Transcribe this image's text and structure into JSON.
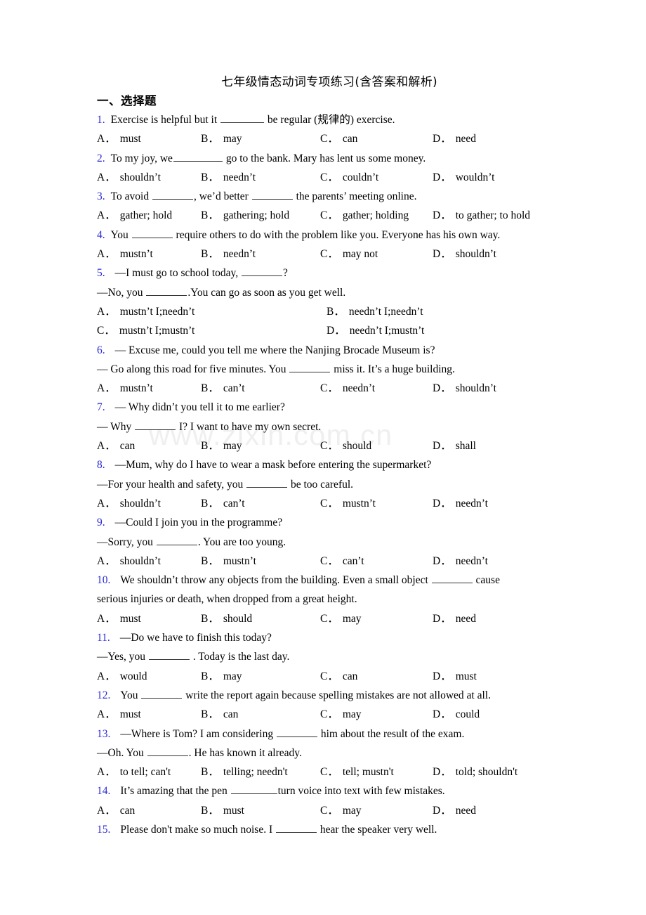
{
  "document": {
    "title": "七年级情态动词专项练习(含答案和解析)",
    "section_heading": "一、选择题",
    "watermark": "www.zixin.com.cn"
  },
  "questions": [
    {
      "number": "1.",
      "stem_parts": [
        "Exercise is helpful but it ",
        " be regular (规律的) exercise."
      ],
      "layout": "4col",
      "options": [
        {
          "key": "A．",
          "text": "must"
        },
        {
          "key": "B．",
          "text": "may"
        },
        {
          "key": "C．",
          "text": "can"
        },
        {
          "key": "D．",
          "text": "need"
        }
      ]
    },
    {
      "number": "2.",
      "stem_parts": [
        "To my joy, we",
        " go to the bank. Mary has lent us some money."
      ],
      "layout": "4col",
      "options": [
        {
          "key": "A．",
          "text": "shouldn’t"
        },
        {
          "key": "B．",
          "text": "needn’t"
        },
        {
          "key": "C．",
          "text": "couldn’t"
        },
        {
          "key": "D．",
          "text": "wouldn’t"
        }
      ]
    },
    {
      "number": "3.",
      "stem_parts": [
        "To avoid ",
        ", we’d better ",
        " the parents’ meeting online."
      ],
      "layout": "4col",
      "options": [
        {
          "key": "A．",
          "text": "gather; hold"
        },
        {
          "key": "B．",
          "text": "gathering; hold"
        },
        {
          "key": "C．",
          "text": "gather; holding"
        },
        {
          "key": "D．",
          "text": "to gather; to hold"
        }
      ]
    },
    {
      "number": "4.",
      "stem_parts": [
        "You ",
        " require others to do with the problem like you. Everyone has his own way."
      ],
      "layout": "4col",
      "options": [
        {
          "key": "A．",
          "text": "mustn’t"
        },
        {
          "key": "B．",
          "text": "needn’t"
        },
        {
          "key": "C．",
          "text": "may not"
        },
        {
          "key": "D．",
          "text": "shouldn’t"
        }
      ]
    },
    {
      "number": "5.",
      "stem_parts": [
        "—I must go to school today, ",
        "?"
      ],
      "stem_line2_parts": [
        "—No, you ",
        ".You can go as soon as you get well."
      ],
      "layout": "2col",
      "options": [
        {
          "key": "A．",
          "text": "mustn’t I;needn’t"
        },
        {
          "key": "B．",
          "text": "needn’t I;needn’t"
        },
        {
          "key": "C．",
          "text": "mustn’t I;mustn’t"
        },
        {
          "key": "D．",
          "text": "needn’t I;mustn’t"
        }
      ]
    },
    {
      "number": "6.",
      "stem_parts": [
        "— Excuse me, could you tell me where the Nanjing Brocade Museum is?"
      ],
      "stem_line2_parts": [
        "— Go along this road for five minutes. You ",
        " miss it. It’s a huge building."
      ],
      "layout": "4col",
      "options": [
        {
          "key": "A．",
          "text": "mustn’t"
        },
        {
          "key": "B．",
          "text": "can’t"
        },
        {
          "key": "C．",
          "text": "needn’t"
        },
        {
          "key": "D．",
          "text": "shouldn’t"
        }
      ]
    },
    {
      "number": "7.",
      "stem_parts": [
        "— Why didn’t you tell it to me earlier?"
      ],
      "stem_line2_parts": [
        "— Why ",
        " I? I want to have my own secret."
      ],
      "layout": "4col",
      "options": [
        {
          "key": "A．",
          "text": "can"
        },
        {
          "key": "B．",
          "text": "may"
        },
        {
          "key": "C．",
          "text": "should"
        },
        {
          "key": "D．",
          "text": "shall"
        }
      ]
    },
    {
      "number": "8.",
      "stem_parts": [
        "—Mum, why do I have to wear a mask before entering the supermarket?"
      ],
      "stem_line2_parts": [
        "—For your health and safety, you ",
        " be too careful."
      ],
      "layout": "4col",
      "options": [
        {
          "key": "A．",
          "text": "shouldn’t"
        },
        {
          "key": "B．",
          "text": "can’t"
        },
        {
          "key": "C．",
          "text": "mustn’t"
        },
        {
          "key": "D．",
          "text": "needn’t"
        }
      ]
    },
    {
      "number": "9.",
      "stem_parts": [
        "—Could I join you in the programme?"
      ],
      "stem_line2_parts": [
        "—Sorry, you ",
        ". You are too young."
      ],
      "layout": "4col",
      "options": [
        {
          "key": "A．",
          "text": "shouldn’t"
        },
        {
          "key": "B．",
          "text": "mustn’t"
        },
        {
          "key": "C．",
          "text": "can’t"
        },
        {
          "key": "D．",
          "text": "needn’t"
        }
      ]
    },
    {
      "number": "10.",
      "stem_parts": [
        "We shouldn’t throw any objects from the building. Even a small object ",
        " cause"
      ],
      "stem_line2_parts": [
        "serious injuries or death, when dropped from a great height."
      ],
      "layout": "4col",
      "options": [
        {
          "key": "A．",
          "text": "must"
        },
        {
          "key": "B．",
          "text": "should"
        },
        {
          "key": "C．",
          "text": "may"
        },
        {
          "key": "D．",
          "text": "need"
        }
      ]
    },
    {
      "number": "11.",
      "stem_parts": [
        "—Do we have to finish this today?"
      ],
      "stem_line2_parts": [
        "—Yes, you ",
        " . Today is the last day."
      ],
      "layout": "4col",
      "options": [
        {
          "key": "A．",
          "text": "would"
        },
        {
          "key": "B．",
          "text": "may"
        },
        {
          "key": "C．",
          "text": "can"
        },
        {
          "key": "D．",
          "text": "must"
        }
      ]
    },
    {
      "number": "12.",
      "stem_parts": [
        "You ",
        " write the report again because spelling mistakes are not allowed at all."
      ],
      "layout": "4col",
      "options": [
        {
          "key": "A．",
          "text": "must"
        },
        {
          "key": "B．",
          "text": "can"
        },
        {
          "key": "C．",
          "text": "may"
        },
        {
          "key": "D．",
          "text": "could"
        }
      ]
    },
    {
      "number": "13.",
      "stem_parts": [
        "—Where is Tom? I am considering ",
        " him about the result of the exam."
      ],
      "stem_line2_parts": [
        "—Oh. You ",
        ". He has known it already."
      ],
      "layout": "4col",
      "options": [
        {
          "key": "A．",
          "text": "to tell; can't"
        },
        {
          "key": "B．",
          "text": "telling; needn't"
        },
        {
          "key": "C．",
          "text": "tell; mustn't"
        },
        {
          "key": "D．",
          "text": "told; shouldn't"
        }
      ]
    },
    {
      "number": "14.",
      "stem_parts": [
        "It’s amazing that the pen ",
        "turn voice into text with few mistakes."
      ],
      "layout": "4col",
      "options": [
        {
          "key": "A．",
          "text": "can"
        },
        {
          "key": "B．",
          "text": "must"
        },
        {
          "key": "C．",
          "text": "may"
        },
        {
          "key": "D．",
          "text": "need"
        }
      ]
    },
    {
      "number": "15.",
      "stem_parts": [
        "Please don't make so much noise. I ",
        " hear the speaker very well."
      ],
      "layout": "none",
      "options": []
    }
  ],
  "colors": {
    "question_number": "#2b2bd6",
    "text": "#000000",
    "watermark": "#efeff1",
    "background": "#ffffff"
  }
}
